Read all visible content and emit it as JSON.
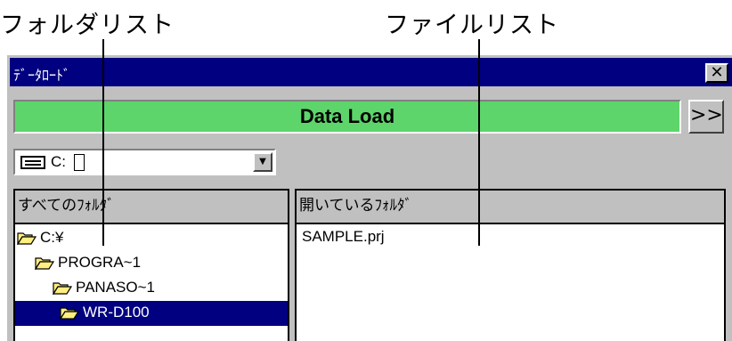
{
  "callouts": {
    "folder_list": "フォルダリスト",
    "file_list": "ファイルリスト"
  },
  "window": {
    "title": "ﾃﾞｰﾀﾛｰﾄﾞ",
    "close": "✕",
    "banner": "Data Load",
    "next": ">>"
  },
  "drive": {
    "label": "C:",
    "dropdown_arrow": "▼"
  },
  "folder_pane": {
    "header": "すべてのﾌｫﾙﾀﾞ",
    "items": [
      {
        "label": "C:¥",
        "selected": false
      },
      {
        "label": "PROGRA~1",
        "selected": false
      },
      {
        "label": "PANASO~1",
        "selected": false
      },
      {
        "label": "WR-D100",
        "selected": true
      }
    ]
  },
  "file_pane": {
    "header": "開いているﾌｫﾙﾀﾞ",
    "files": [
      "SAMPLE.prj"
    ]
  },
  "colors": {
    "title_bar": "#000080",
    "banner": "#5dd56b",
    "selection": "#000080",
    "window_face": "#c0c0c0",
    "folder_fill": "#ffee80"
  }
}
